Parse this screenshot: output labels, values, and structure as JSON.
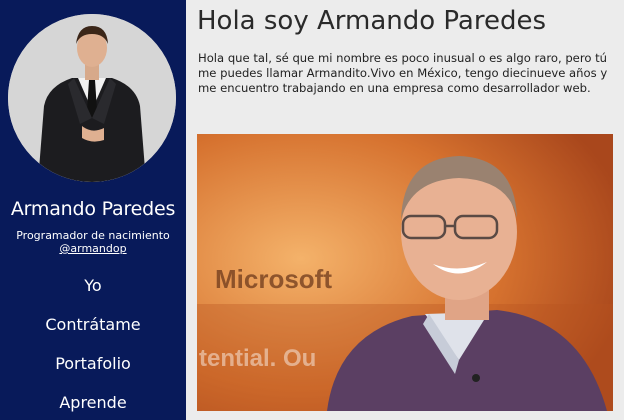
{
  "profile": {
    "name": "Armando Paredes",
    "subtitle": "Programador de nacimiento",
    "handle": "@armandop"
  },
  "nav": {
    "items": [
      {
        "label": "Yo"
      },
      {
        "label": "Contrátame"
      },
      {
        "label": "Portafolio"
      },
      {
        "label": "Aprende"
      }
    ]
  },
  "main": {
    "title": "Hola soy Armando Paredes",
    "intro": "Hola que tal, sé que mi nombre es poco inusual o es algo raro, pero tú me puedes llamar Armandito.Vivo en México, tengo diecinueve años y me encuentro trabajando en una empresa como desarrollador web.",
    "photo_backdrop_text": "Microsoft",
    "photo_backdrop_text_2": "tential. Ou"
  },
  "colors": {
    "sidebar_bg": "#081a5a",
    "page_bg": "#ececec",
    "text": "#222222"
  }
}
